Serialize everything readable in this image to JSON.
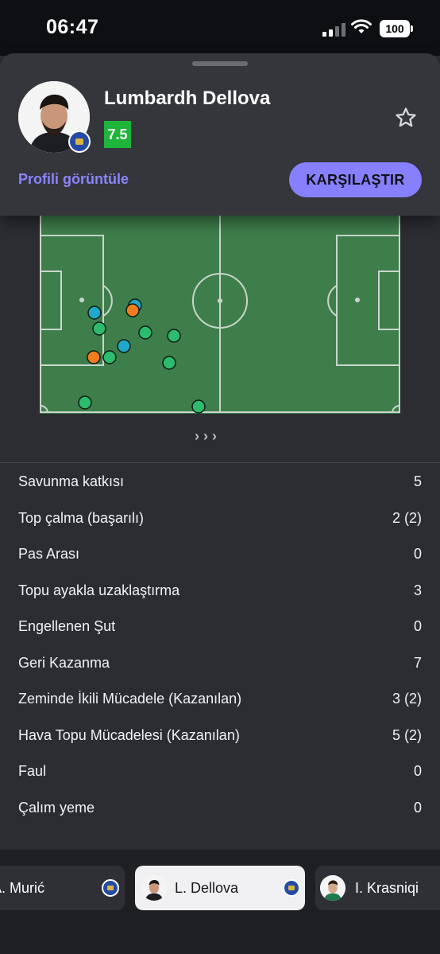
{
  "status_bar": {
    "time": "06:47",
    "battery": "100"
  },
  "player": {
    "name": "Lumbardh Dellova",
    "rating": "7.5",
    "rating_color": "#1fb53a",
    "profile_link": "Profili görüntüle",
    "compare_button": "KARŞILAŞTIR"
  },
  "heatmap": {
    "arrows": "› › ›",
    "legend_colors": {
      "green": "#2dbb6e",
      "blue": "#1fa8c9",
      "orange": "#f07d1e"
    }
  },
  "stats": [
    {
      "label": "Savunma katkısı",
      "value": "5"
    },
    {
      "label": "Top çalma (başarılı)",
      "value": "2 (2)"
    },
    {
      "label": "Pas Arası",
      "value": "0"
    },
    {
      "label": "Topu ayakla uzaklaştırma",
      "value": "3"
    },
    {
      "label": "Engellenen Şut",
      "value": "0"
    },
    {
      "label": "Geri Kazanma",
      "value": "7"
    },
    {
      "label": "Zeminde İkili Mücadele (Kazanılan)",
      "value": "3 (2)"
    },
    {
      "label": "Hava Topu Mücadelesi (Kazanılan)",
      "value": "5 (2)"
    },
    {
      "label": "Faul",
      "value": "0"
    },
    {
      "label": "Çalım yeme",
      "value": "0"
    }
  ],
  "player_switcher": {
    "prev": "A. Murić",
    "current": "L. Dellova",
    "next": "I. Krasniqi"
  }
}
